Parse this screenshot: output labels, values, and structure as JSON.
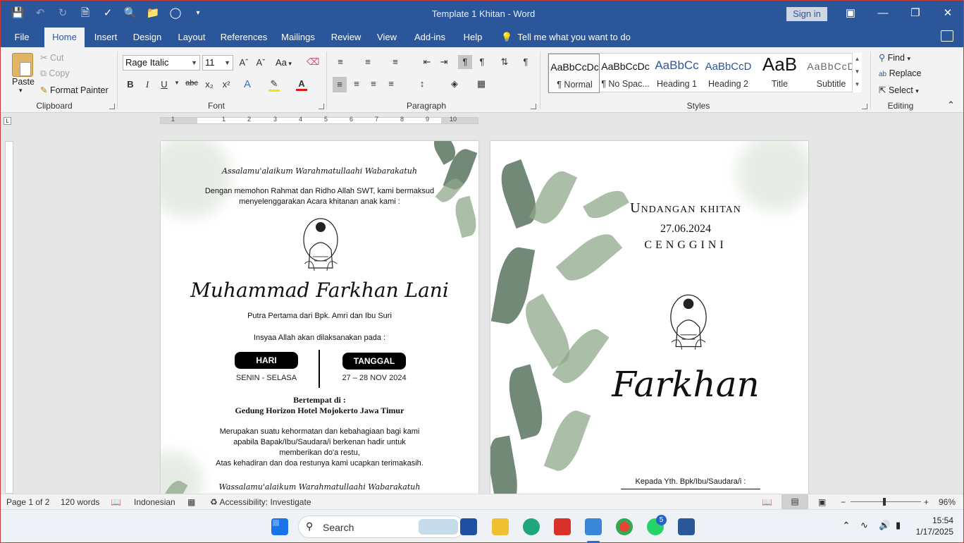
{
  "window": {
    "title": "Template 1 Khitan - Word",
    "sign_in": "Sign in"
  },
  "tabs": [
    "File",
    "Home",
    "Insert",
    "Design",
    "Layout",
    "References",
    "Mailings",
    "Review",
    "View",
    "Add-ins",
    "Help"
  ],
  "tell_me": "Tell me what you want to do",
  "clipboard": {
    "paste": "Paste",
    "cut": "Cut",
    "copy": "Copy",
    "format_painter": "Format Painter",
    "label": "Clipboard"
  },
  "font": {
    "name": "Rage Italic",
    "size": "11",
    "label": "Font",
    "change_case": "Aa"
  },
  "paragraph": {
    "label": "Paragraph"
  },
  "styles": {
    "label": "Styles",
    "items": [
      {
        "sample": "AaBbCcDc",
        "name": "¶ Normal"
      },
      {
        "sample": "AaBbCcDc",
        "name": "¶ No Spac..."
      },
      {
        "sample": "AaBbCc",
        "name": "Heading 1"
      },
      {
        "sample": "AaBbCcD",
        "name": "Heading 2"
      },
      {
        "sample": "AaB",
        "name": "Title"
      },
      {
        "sample": "AaBbCcD",
        "name": "Subtitle"
      }
    ]
  },
  "editing": {
    "find": "Find",
    "replace": "Replace",
    "select": "Select",
    "label": "Editing"
  },
  "ruler": {
    "numbers": [
      "1",
      "1",
      "2",
      "3",
      "4",
      "5",
      "6",
      "7",
      "8",
      "9",
      "10"
    ]
  },
  "page1": {
    "greeting": "Assalamu'alaikum Warahmatullaahi Wabarakatuh",
    "intro_line1": "Dengan memohon Rahmat dan Ridho Allah SWT, kami bermaksud",
    "intro_line2": "menyelenggarakan Acara khitanan anak kami :",
    "child_name": "Muhammad Farkhan Lani",
    "parents": "Putra Pertama dari Bpk. Amri dan Ibu Suri",
    "held_on": "Insyaa Allah akan dilaksanakan pada :",
    "day_label": "HARI",
    "day_value": "SENIN - SELASA",
    "date_label": "TANGGAL",
    "date_value": "27 – 28 NOV 2024",
    "venue_label": "Bertempat di :",
    "venue": "Gedung Horizon Hotel Mojokerto Jawa Timur",
    "closing_line1": "Merupakan suatu kehormatan dan kebahagiaan bagi kami",
    "closing_line2": "apabila Bapak/Ibu/Saudara/i berkenan hadir untuk",
    "closing_line3": "memberikan do'a restu,",
    "closing_line4": "Atas kehadiran dan doa restunya kami ucapkan terimakasih.",
    "farewell": "Wassalamu'alaikum Warahmatullaahi Wabarakatuh"
  },
  "page2": {
    "heading": "Undangan khitan",
    "date": "27.06.2024",
    "place": "CENGGINI",
    "name": "Farkhan",
    "to": "Kepada Yth. Bpk/Ibu/Saudara/i :"
  },
  "status": {
    "page": "Page 1 of 2",
    "words": "120 words",
    "language": "Indonesian",
    "accessibility": "Accessibility: Investigate",
    "zoom": "96%"
  },
  "taskbar": {
    "search": "Search",
    "time": "15:54",
    "date": "1/17/2025",
    "whatsapp_badge": "5"
  }
}
